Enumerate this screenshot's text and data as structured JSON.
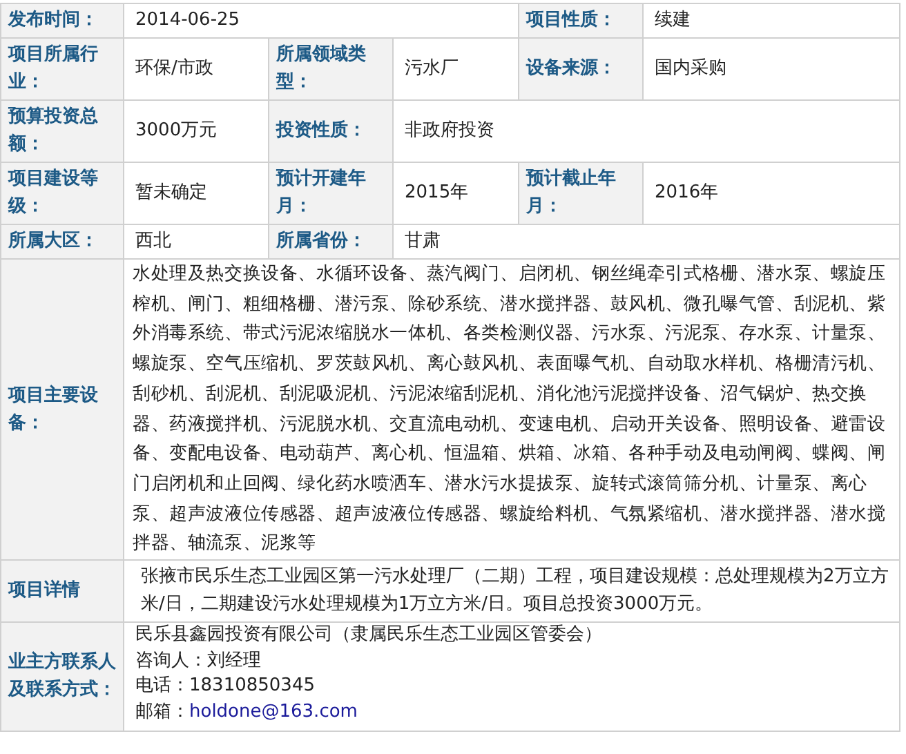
{
  "info_rows": [
    [
      {
        "label": "发布时间：",
        "value": "2014-06-25",
        "kind": "wide"
      },
      {
        "label": "项目性质：",
        "value": "续建",
        "kind": "normal"
      }
    ],
    [
      {
        "label": "项目所属行业：",
        "value": "环保/市政",
        "kind": "normal"
      },
      {
        "label": "所属领域类型：",
        "value": "污水厂",
        "kind": "normal"
      },
      {
        "label": "设备来源：",
        "value": "国内采购",
        "kind": "normal"
      }
    ],
    [
      {
        "label": "预算投资总额：",
        "value": "3000万元",
        "kind": "normal"
      },
      {
        "label": "投资性质：",
        "value": "非政府投资",
        "kind": "wide"
      }
    ],
    [
      {
        "label": "项目建设等级：",
        "value": "暂未确定",
        "kind": "normal"
      },
      {
        "label": "预计开建年月：",
        "value": "2015年",
        "kind": "normal"
      },
      {
        "label": "预计截止年月：",
        "value": "2016年",
        "kind": "normal"
      }
    ],
    [
      {
        "label": "所属大区：",
        "value": "西北",
        "kind": "normal"
      },
      {
        "label": "所属省份：",
        "value": "甘肃",
        "kind": "wide"
      }
    ]
  ],
  "equipment": {
    "label": "项目主要设备：",
    "value": "水处理及热交换设备、水循环设备、蒸汽阀门、启闭机、钢丝绳牵引式格栅、潜水泵、螺旋压榨机、闸门、粗细格栅、潜污泵、除砂系统、潜水搅拌器、鼓风机、微孔曝气管、刮泥机、紫外消毒系统、带式污泥浓缩脱水一体机、各类检测仪器、污水泵、污泥泵、存水泵、计量泵、螺旋泵、空气压缩机、罗茨鼓风机、离心鼓风机、表面曝气机、自动取水样机、格栅清污机、刮砂机、刮泥机、刮泥吸泥机、污泥浓缩刮泥机、消化池污泥搅拌设备、沼气锅炉、热交换器、药液搅拌机、污泥脱水机、交直流电动机、变速电机、启动开关设备、照明设备、避雷设备、变配电设备、电动葫芦、离心机、恒温箱、烘箱、冰箱、各种手动及电动闸阀、蝶阀、闸门启闭机和止回阀、绿化药水喷洒车、潜水污水提拔泵、旋转式滚筒筛分机、计量泵、离心泵、超声波液位传感器、超声波液位传感器、螺旋给料机、气氛紧缩机、潜水搅拌器、潜水搅拌器、轴流泵、泥浆等"
  },
  "details": {
    "label": "项目详情",
    "value": "张掖市民乐生态工业园区第一污水处理厂（二期）工程，项目建设规模：总处理规模为2万立方米/日，二期建设污水处理规模为1万立方米/日。项目总投资3000万元。"
  },
  "contact": {
    "label": "业主方联系人及联系方式：",
    "lines": [
      "民乐县鑫园投资有限公司（隶属民乐生态工业园区管委会）",
      "咨询人：刘经理",
      "电话：18310850345"
    ],
    "email_label": "邮箱：",
    "email": "holdone@163.com"
  }
}
